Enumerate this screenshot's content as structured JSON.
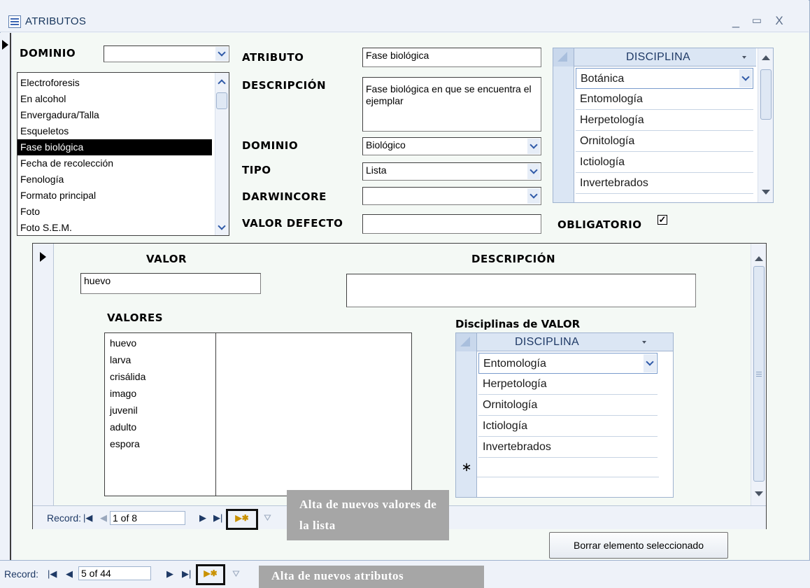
{
  "window": {
    "title": "ATRIBUTOS",
    "minimize": "_",
    "maximize": "▭",
    "close": "X"
  },
  "dominio_filter": {
    "label": "DOMINIO",
    "value": ""
  },
  "attributes_list": {
    "items": [
      "Electroforesis",
      "En alcohol",
      "Envergadura/Talla",
      "Esqueletos",
      "Fase biológica",
      "Fecha de recolección",
      "Fenología",
      "Formato principal",
      "Foto",
      "Foto S.E.M."
    ],
    "selected_index": 4
  },
  "fields": {
    "atributo": {
      "label": "ATRIBUTO",
      "value": "Fase biológica"
    },
    "descripcion": {
      "label": "DESCRIPCIÓN",
      "value": "Fase biológica en que se encuentra el ejemplar"
    },
    "dominio": {
      "label": "DOMINIO",
      "value": "Biológico"
    },
    "tipo": {
      "label": "TIPO",
      "value": "Lista"
    },
    "darwincore": {
      "label": "DARWINCORE",
      "value": ""
    },
    "valor_defecto": {
      "label": "VALOR DEFECTO",
      "value": ""
    },
    "obligatorio": {
      "label": "OBLIGATORIO",
      "checked": true,
      "mark": "✓"
    }
  },
  "disciplinas_top": {
    "header": "DISCIPLINA",
    "rows": [
      "Botánica",
      "Entomología",
      "Herpetología",
      "Ornitología",
      "Ictiología",
      "Invertebrados"
    ]
  },
  "subform": {
    "valor": {
      "label": "VALOR",
      "value": "huevo"
    },
    "descripcion": {
      "label": "DESCRIPCIÓN",
      "value": ""
    },
    "valores": {
      "label": "VALORES",
      "items": [
        "huevo",
        "larva",
        "crisálida",
        "imago",
        "juvenil",
        "adulto",
        "espora"
      ]
    },
    "disciplinas_valor": {
      "label": "Disciplinas de VALOR",
      "header": "DISCIPLINA",
      "rows": [
        "Entomología",
        "Herpetología",
        "Ornitología",
        "Ictiología",
        "Invertebrados"
      ],
      "new_row_marker": "∗"
    },
    "nav": {
      "label": "Record:",
      "position": "1 of 8"
    }
  },
  "main_nav": {
    "label": "Record:",
    "position": "5 of 44"
  },
  "delete_button": "Borrar elemento seleccionado",
  "callouts": {
    "new_values": "Alta de nuevos valores de la lista",
    "new_attributes": "Alta de nuevos atributos"
  }
}
